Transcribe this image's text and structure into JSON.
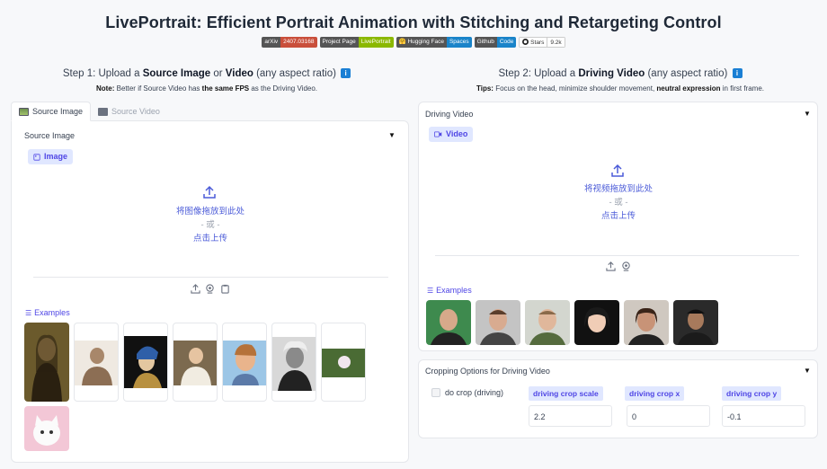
{
  "title": "LivePortrait: Efficient Portrait Animation with Stitching and Retargeting Control",
  "badges": [
    {
      "left": "arXiv",
      "right": "2407.03168",
      "left_color": "#555555",
      "right_color": "#c94f3b"
    },
    {
      "left": "Project Page",
      "right": "LivePortrait",
      "left_color": "#555555",
      "right_color": "#8bb800"
    },
    {
      "left": "🤗 Hugging Face",
      "right": "Spaces",
      "left_color": "#555555",
      "right_color": "#1a84c9"
    },
    {
      "left": "Github",
      "right": "Code",
      "left_color": "#555555",
      "right_color": "#1a84c9"
    },
    {
      "left": "Stars",
      "right": "9.2k"
    }
  ],
  "step1": {
    "prefix": "Step 1: Upload a ",
    "bold1": "Source Image",
    "mid": " or ",
    "bold2": "Video",
    "suffix": " (any aspect ratio) ",
    "note_label": "Note:",
    "note_text1": " Better if Source Video has ",
    "note_bold": "the same FPS",
    "note_text2": " as the Driving Video."
  },
  "step2": {
    "prefix": "Step 2: Upload a ",
    "bold": "Driving Video",
    "suffix": " (any aspect ratio) ",
    "tips_label": "Tips:",
    "tips_text1": " Focus on the head, minimize shoulder movement, ",
    "tips_bold": "neutral expression",
    "tips_text2": " in first frame."
  },
  "info_glyph": "i",
  "tabs": {
    "source_image": "Source Image",
    "source_video": "Source Video"
  },
  "source_panel": {
    "label": "Source Image",
    "chip": "Image",
    "drop": "将图像拖放到此处",
    "or": "- 或 -",
    "click": "点击上传",
    "examples": "Examples"
  },
  "driving_panel": {
    "label": "Driving Video",
    "chip": "Video",
    "drop": "将视频拖放到此处",
    "or": "- 或 -",
    "click": "点击上传",
    "examples": "Examples"
  },
  "cropping": {
    "title": "Cropping Options for Driving Video",
    "checkbox": "do crop (driving)",
    "scale_label": "driving crop scale",
    "scale_value": "2.2",
    "x_label": "driving crop x",
    "x_value": "0",
    "y_label": "driving crop y",
    "y_value": "-0.1"
  },
  "caret": "▼",
  "colors": {
    "accent": "#4f46e5",
    "chip_bg": "#e0e7ff",
    "info": "#1a7fd4"
  }
}
